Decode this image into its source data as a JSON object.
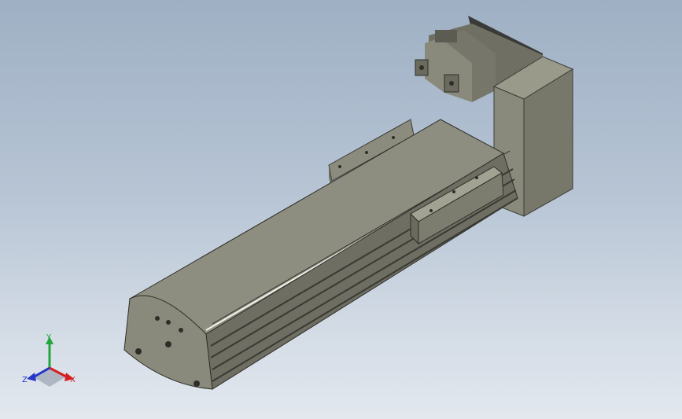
{
  "viewport": {
    "background_top": "#9fb0c4",
    "background_bottom": "#e3e8ef"
  },
  "model": {
    "body_color": "#8c8c7e",
    "body_dark": "#55554c",
    "motor_color": "#7d7d70",
    "highlight": "#f3f3ee"
  },
  "triad": {
    "x_label": "X",
    "y_label": "Y",
    "z_label": "Z",
    "x_color": "#d42020",
    "y_color": "#22a63a",
    "z_color": "#2536c8"
  }
}
